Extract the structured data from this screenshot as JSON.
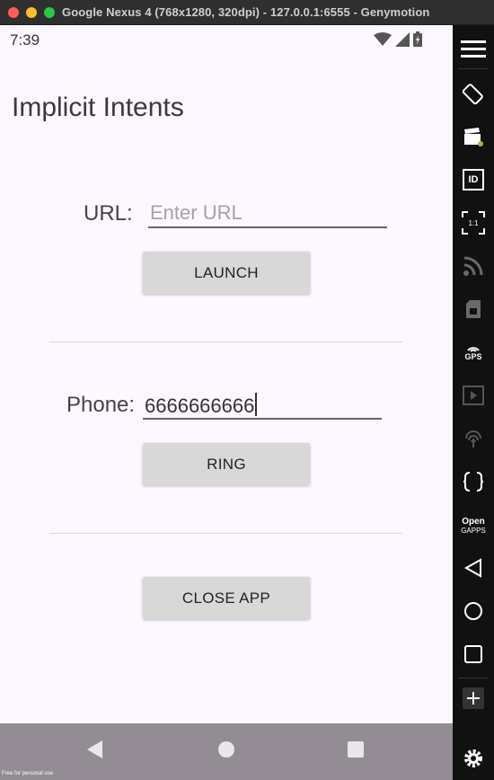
{
  "window": {
    "title": "Google Nexus 4 (768x1280, 320dpi) - 127.0.0.1:6555 - Genymotion"
  },
  "statusbar": {
    "time": "7:39"
  },
  "app": {
    "title": "Implicit Intents",
    "url": {
      "label": "URL:",
      "placeholder": "Enter URL",
      "value": ""
    },
    "launch_button": "LAUNCH",
    "phone": {
      "label": "Phone:",
      "value": "6666666666"
    },
    "ring_button": "RING",
    "close_button": "CLOSE APP"
  },
  "sidepanel": {
    "tools": [
      "menu-icon",
      "rotate-icon",
      "camera-icon",
      "device-id-icon",
      "pixel-perfect-icon",
      "network-icon",
      "sim-icon",
      "gps-icon",
      "media-icon",
      "fingerprint-icon",
      "capture-icon",
      "opengapps-icon",
      "back-icon",
      "home-icon",
      "recents-icon",
      "volume-up-icon",
      "settings-icon"
    ],
    "id_label": "ID",
    "ratio_label": "1:1",
    "gps_label": "GPS",
    "gapps_label_1": "Open",
    "gapps_label_2": "GAPPS"
  },
  "watermark": "Free for personal use",
  "colors": {
    "screen_bg": "#fdf7ff",
    "button_bg": "#d8d8d8",
    "navbar_bg": "#948c94",
    "panel_bg": "#111111"
  }
}
